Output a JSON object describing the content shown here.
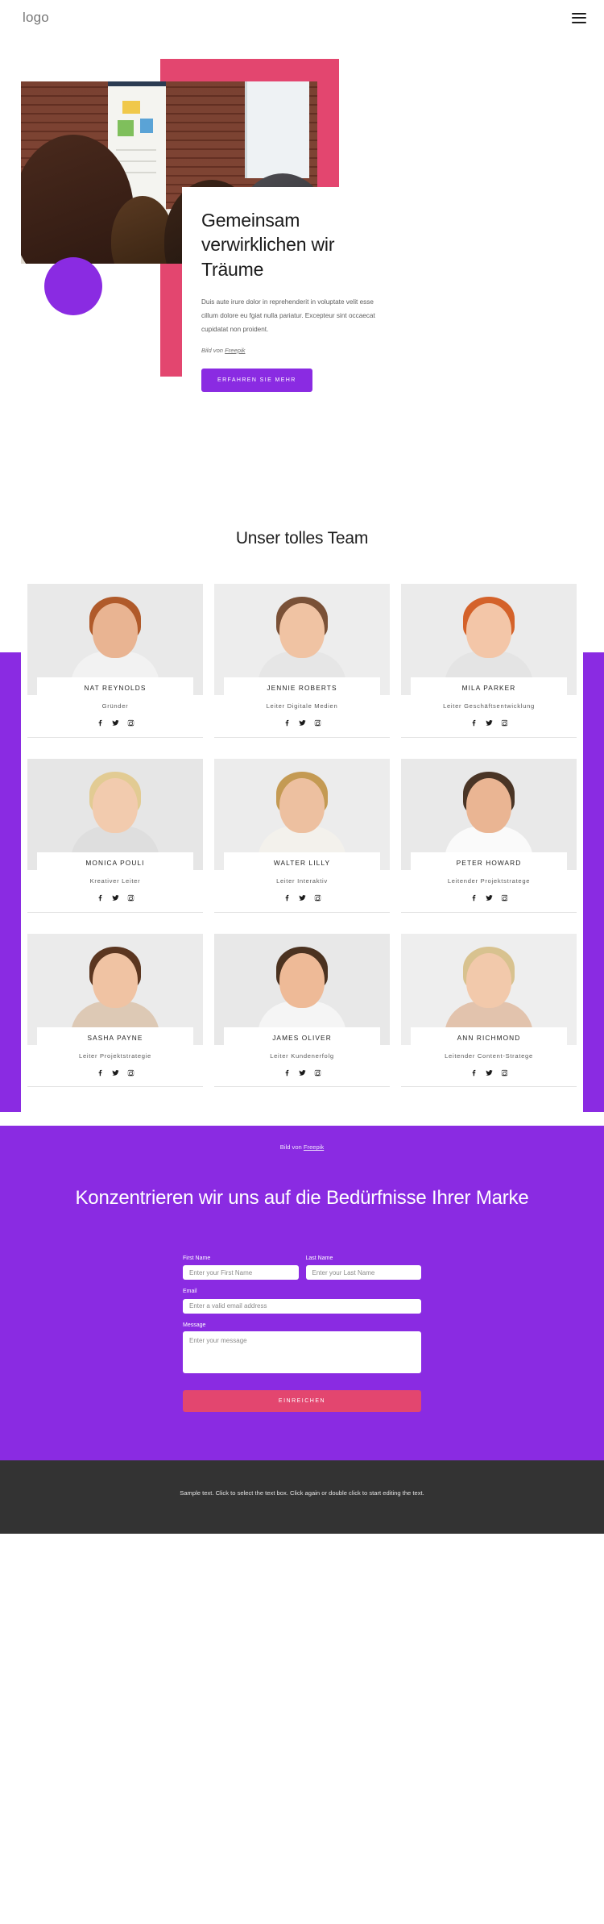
{
  "header": {
    "logo": "logo",
    "menu_icon": "hamburger-menu-icon"
  },
  "hero": {
    "title": "Gemeinsam verwirklichen wir Träume",
    "paragraph": "Duis aute irure dolor in reprehenderit in voluptate velit esse cillum dolore eu fgiat nulla pariatur. Excepteur sint occaecat cupidatat non proident.",
    "credit_prefix": "Bild von ",
    "credit_link": "Freepik",
    "cta_label": "ERFAHREN SIE MEHR",
    "colors": {
      "pink": "#e3466f",
      "purple": "#8a2be2"
    }
  },
  "team": {
    "heading": "Unser tolles Team",
    "social_icons": [
      "facebook-icon",
      "twitter-icon",
      "instagram-icon"
    ],
    "members": [
      {
        "name": "NAT REYNOLDS",
        "role": "Gründer"
      },
      {
        "name": "JENNIE ROBERTS",
        "role": "Leiter Digitale Medien"
      },
      {
        "name": "MILA PARKER",
        "role": "Leiter Geschäftsentwicklung"
      },
      {
        "name": "MONICA POULI",
        "role": "Kreativer Leiter"
      },
      {
        "name": "WALTER LILLY",
        "role": "Leiter Interaktiv"
      },
      {
        "name": "PETER HOWARD",
        "role": "Leitender Projektstratege"
      },
      {
        "name": "SASHA PAYNE",
        "role": "Leiter Projektstrategie"
      },
      {
        "name": "JAMES OLIVER",
        "role": "Leiter Kundenerfolg"
      },
      {
        "name": "ANN RICHMOND",
        "role": "Leitender Content-Stratege"
      }
    ]
  },
  "band": {
    "credit_prefix": "Bild von ",
    "credit_link": "Freepik"
  },
  "form": {
    "heading": "Konzentrieren wir uns auf die Bedürfnisse Ihrer Marke",
    "first_name": {
      "label": "First Name",
      "placeholder": "Enter your First Name",
      "value": ""
    },
    "last_name": {
      "label": "Last Name",
      "placeholder": "Enter your Last Name",
      "value": ""
    },
    "email": {
      "label": "Email",
      "placeholder": "Enter a valid email address",
      "value": ""
    },
    "message": {
      "label": "Message",
      "placeholder": "Enter your message",
      "value": ""
    },
    "submit_label": "EINREICHEN"
  },
  "footer": {
    "text": "Sample text. Click to select the text box. Click again or double click to start editing the text."
  }
}
